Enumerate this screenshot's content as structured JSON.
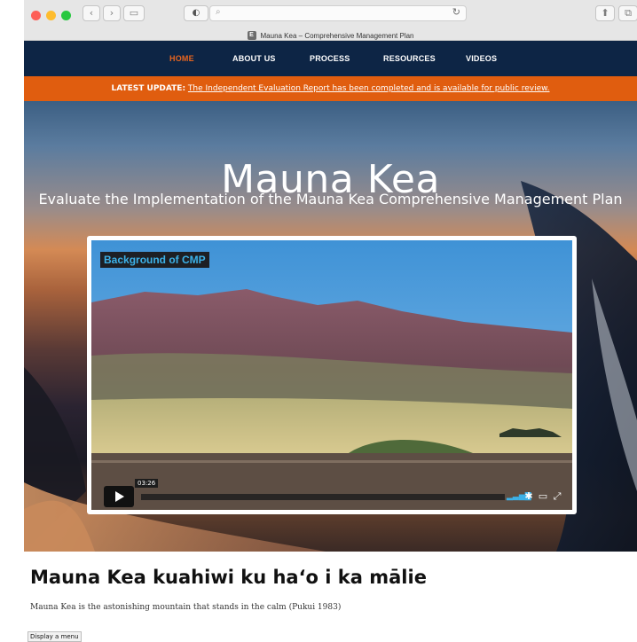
{
  "browser": {
    "tab_title": "Mauna Kea – Comprehensive Management Plan",
    "favicon_letter": "E",
    "traffic_lights": [
      "#fd5f57",
      "#febc2e",
      "#28c840"
    ],
    "buttons": {
      "back": "‹",
      "forward": "›",
      "sidebar": "▭",
      "shield": "◐",
      "reload": "↻",
      "search": "⌕",
      "share": "⬆",
      "tabs": "⧉"
    }
  },
  "nav": {
    "items": [
      {
        "label": "HOME",
        "active": true
      },
      {
        "label": "ABOUT US",
        "active": false
      },
      {
        "label": "PROCESS",
        "active": false
      },
      {
        "label": "RESOURCES",
        "active": false
      },
      {
        "label": "VIDEOS",
        "active": false
      }
    ]
  },
  "banner": {
    "label": "LATEST UPDATE:",
    "link_text": "The Independent Evaluation Report has been completed and is available for public review."
  },
  "hero": {
    "title": "Mauna Kea",
    "subtitle": "Evaluate the Implementation of the Mauna Kea Comprehensive Management Plan"
  },
  "video": {
    "label": "Background of CMP",
    "timecode": "03:26",
    "icons": {
      "volume": "volume-icon",
      "settings": "settings-icon",
      "airplay": "airplay-icon",
      "fullscreen": "fullscreen-icon"
    }
  },
  "content": {
    "heading": "Mauna Kea kuahiwi ku haʻo i ka mālie",
    "intro_link": "Mauna Kea",
    "intro_rest": " is the astonishing mountain that stands in the calm (Pukui 1983)"
  },
  "tooltip": "Display a menu",
  "colors": {
    "nav_bg": "#0d2545",
    "accent": "#e05d0f",
    "active_nav": "#e8651f",
    "video_label": "#3cb1e8"
  }
}
